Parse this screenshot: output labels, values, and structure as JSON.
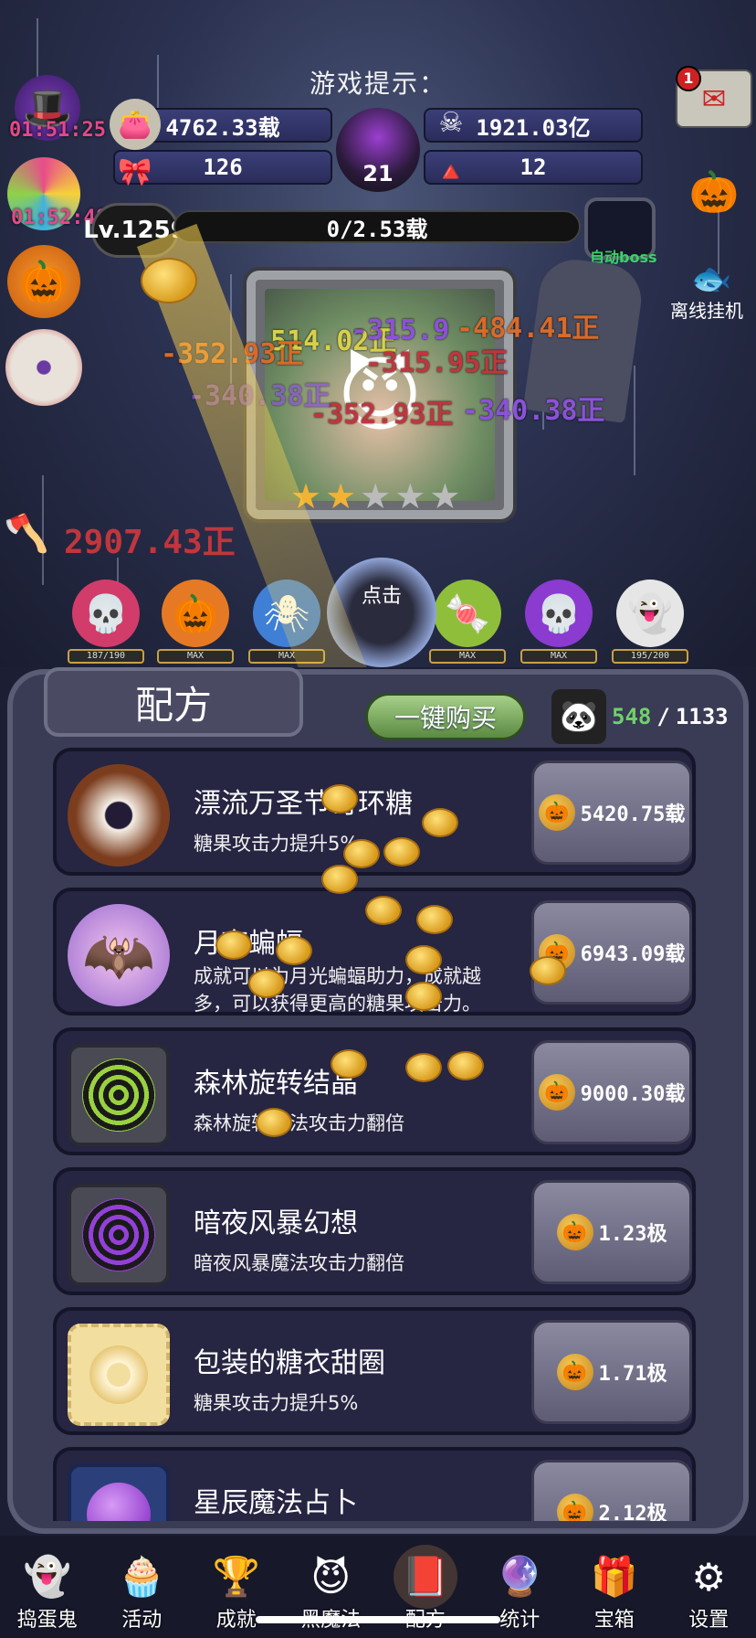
{
  "hud": {
    "tip_label": "游戏提示：",
    "candy_amount": "4762.33载",
    "gold_amount": "1921.03亿",
    "bow_count": "126",
    "cauldron_level": "21",
    "corn_count": "12",
    "timer_hat": "01:51:25",
    "timer_candy": "01:52:48",
    "mail_badge": "1"
  },
  "level": {
    "label": "Lv.1259",
    "exp": "0/2.53载",
    "auto_boss": "自动boss"
  },
  "offline": {
    "label": "离线挂机"
  },
  "damage_numbers": [
    "514.02正",
    "-315.9",
    "-484.41正",
    "-352.93正",
    "-340.38正",
    "-315.95正",
    "-352.93正",
    "-340.38正"
  ],
  "axe_damage": "2907.43正",
  "tap_label": "点击",
  "minions": [
    {
      "name": "pink-skull",
      "cap": "187/190",
      "color": "#d23c6a"
    },
    {
      "name": "pumpkin",
      "cap": "MAX",
      "color": "#e67a24"
    },
    {
      "name": "spider",
      "cap": "MAX",
      "color": "#3f7fd6"
    },
    {
      "name": "green-candy",
      "cap": "MAX",
      "color": "#8fbf3a"
    },
    {
      "name": "purple-skull",
      "cap": "MAX",
      "color": "#8b3bcf"
    },
    {
      "name": "ghost",
      "cap": "195/200",
      "color": "#e6e6e6"
    }
  ],
  "panel": {
    "tab": "配方",
    "buy_all": "一键购买",
    "owned": "548",
    "total": "1133",
    "separator": "/"
  },
  "recipes": [
    {
      "title": "漂流万圣节奇环糖",
      "desc": "糖果攻击力提升5%",
      "price": "5420.75载",
      "icon": "donut"
    },
    {
      "title": "月夜蝙蝠",
      "desc": "成就可以为月光蝙蝠助力，成就越多，可以获得更高的糖果攻击力。",
      "price": "6943.09载",
      "icon": "bat"
    },
    {
      "title": "森林旋转结晶",
      "desc": "森林旋转魔法攻击力翻倍",
      "price": "9000.30载",
      "icon": "green-swirl"
    },
    {
      "title": "暗夜风暴幻想",
      "desc": "暗夜风暴魔法攻击力翻倍",
      "price": "1.23极",
      "icon": "purple-swirl"
    },
    {
      "title": "包装的糖衣甜圈",
      "desc": "糖果攻击力提升5%",
      "price": "1.71极",
      "icon": "wrapped-donut"
    },
    {
      "title": "星辰魔法占卜",
      "desc": "",
      "price": "2.12极",
      "icon": "crystal-ball"
    }
  ],
  "nav": [
    {
      "label": "捣蛋鬼",
      "icon": "ghost-icon"
    },
    {
      "label": "活动",
      "icon": "cupcake-icon"
    },
    {
      "label": "成就",
      "icon": "trophy-icon"
    },
    {
      "label": "黑魔法",
      "icon": "demon-icon"
    },
    {
      "label": "配方",
      "icon": "book-icon"
    },
    {
      "label": "统计",
      "icon": "orb-icon"
    },
    {
      "label": "宝箱",
      "icon": "chest-icon"
    },
    {
      "label": "设置",
      "icon": "gear-icon"
    }
  ],
  "colors": {
    "accent_green": "#6fd16a",
    "damage_red": "#c0363d",
    "damage_purple": "#8b52d8",
    "damage_orange": "#d86a2a"
  }
}
